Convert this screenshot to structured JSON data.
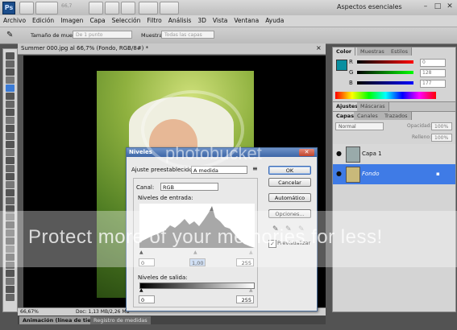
{
  "titlebar": {
    "app_logo": "Ps",
    "zoom": "66,7",
    "workspace": "Aspectos esenciales",
    "window_controls": [
      "–",
      "□",
      "✕"
    ]
  },
  "menu": [
    "Archivo",
    "Edición",
    "Imagen",
    "Capa",
    "Selección",
    "Filtro",
    "Análisis",
    "3D",
    "Vista",
    "Ventana",
    "Ayuda"
  ],
  "options_bar": {
    "sample_size_label": "Tamaño de muestra:",
    "sample_size_value": "De 1 punto",
    "sample_label": "Muestra:",
    "sample_value": "Todas las capas"
  },
  "document": {
    "tab_title": "Summer 000.jpg al 66,7% (Fondo, RGB/8#) *",
    "status_zoom": "66,67%",
    "status_doc": "Doc: 1,13 MB/2,26 MB"
  },
  "bottom_tabs": [
    "Animación (línea de tiempo)",
    "Registro de medidas"
  ],
  "color_panel": {
    "tabs": [
      "Color",
      "Muestras",
      "Estilos"
    ],
    "rows": [
      {
        "channel": "R",
        "value": "0",
        "color": "#e05a5a"
      },
      {
        "channel": "G",
        "value": "128",
        "color": "#5ab85a"
      },
      {
        "channel": "B",
        "value": "177",
        "color": "#5a7fe0"
      }
    ],
    "foreground": "#0a8fa0"
  },
  "adjust_tabs": [
    "Ajustes",
    "Máscaras"
  ],
  "layers_panel": {
    "tabs": [
      "Capas",
      "Canales",
      "Trazados"
    ],
    "blend_mode": "Normal",
    "opacity_label": "Opacidad:",
    "opacity_value": "100%",
    "fill_label": "Relleno:",
    "fill_value": "100%",
    "layers": [
      {
        "name": "Capa 1",
        "selected": false
      },
      {
        "name": "Fondo",
        "selected": true
      }
    ]
  },
  "levels_dialog": {
    "title": "Niveles",
    "preset_label": "Ajuste preestablecido:",
    "preset_value": "A medida",
    "channel_label": "Canal:",
    "channel_value": "RGB",
    "input_levels_label": "Niveles de entrada:",
    "input_black": "0",
    "input_gamma": "1,00",
    "input_white": "255",
    "output_levels_label": "Niveles de salida:",
    "output_black": "0",
    "output_white": "255",
    "buttons": {
      "ok": "OK",
      "cancel": "Cancelar",
      "auto": "Automático",
      "options": "Opciones..."
    },
    "preview_label": "Previsualizar",
    "preview_checked": true
  },
  "watermark": {
    "text": "Protect more of your memories for less!",
    "logo_text": "photobucket"
  }
}
